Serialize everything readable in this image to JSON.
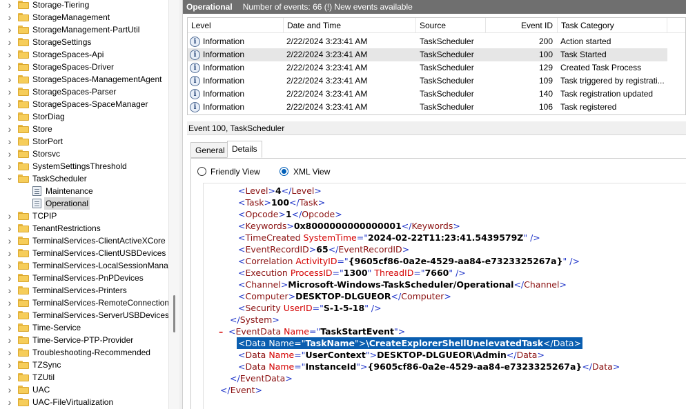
{
  "tree": {
    "items": [
      {
        "label": "Storage-Tiering",
        "type": "folder",
        "expanded": false
      },
      {
        "label": "StorageManagement",
        "type": "folder",
        "expanded": false
      },
      {
        "label": "StorageManagement-PartUtil",
        "type": "folder",
        "expanded": false
      },
      {
        "label": "StorageSettings",
        "type": "folder",
        "expanded": false
      },
      {
        "label": "StorageSpaces-Api",
        "type": "folder",
        "expanded": false
      },
      {
        "label": "StorageSpaces-Driver",
        "type": "folder",
        "expanded": false
      },
      {
        "label": "StorageSpaces-ManagementAgent",
        "type": "folder",
        "expanded": false
      },
      {
        "label": "StorageSpaces-Parser",
        "type": "folder",
        "expanded": false
      },
      {
        "label": "StorageSpaces-SpaceManager",
        "type": "folder",
        "expanded": false
      },
      {
        "label": "StorDiag",
        "type": "folder",
        "expanded": false
      },
      {
        "label": "Store",
        "type": "folder",
        "expanded": false
      },
      {
        "label": "StorPort",
        "type": "folder",
        "expanded": false
      },
      {
        "label": "Storsvc",
        "type": "folder",
        "expanded": false
      },
      {
        "label": "SystemSettingsThreshold",
        "type": "folder",
        "expanded": false
      },
      {
        "label": "TaskScheduler",
        "type": "folder",
        "expanded": true
      },
      {
        "label": "Maintenance",
        "type": "log",
        "child": true
      },
      {
        "label": "Operational",
        "type": "log",
        "child": true,
        "selected": true
      },
      {
        "label": "TCPIP",
        "type": "folder",
        "expanded": false
      },
      {
        "label": "TenantRestrictions",
        "type": "folder",
        "expanded": false
      },
      {
        "label": "TerminalServices-ClientActiveXCore",
        "type": "folder",
        "expanded": false
      },
      {
        "label": "TerminalServices-ClientUSBDevices",
        "type": "folder",
        "expanded": false
      },
      {
        "label": "TerminalServices-LocalSessionManag",
        "type": "folder",
        "expanded": false
      },
      {
        "label": "TerminalServices-PnPDevices",
        "type": "folder",
        "expanded": false
      },
      {
        "label": "TerminalServices-Printers",
        "type": "folder",
        "expanded": false
      },
      {
        "label": "TerminalServices-RemoteConnection",
        "type": "folder",
        "expanded": false
      },
      {
        "label": "TerminalServices-ServerUSBDevices",
        "type": "folder",
        "expanded": false
      },
      {
        "label": "Time-Service",
        "type": "folder",
        "expanded": false
      },
      {
        "label": "Time-Service-PTP-Provider",
        "type": "folder",
        "expanded": false
      },
      {
        "label": "Troubleshooting-Recommended",
        "type": "folder",
        "expanded": false
      },
      {
        "label": "TZSync",
        "type": "folder",
        "expanded": false
      },
      {
        "label": "TZUtil",
        "type": "folder",
        "expanded": false
      },
      {
        "label": "UAC",
        "type": "folder",
        "expanded": false
      },
      {
        "label": "UAC-FileVirtualization",
        "type": "folder",
        "expanded": false
      }
    ]
  },
  "list_header": {
    "title": "Operational",
    "count": "Number of events: 66 (!) New events available"
  },
  "columns": [
    "Level",
    "Date and Time",
    "Source",
    "Event ID",
    "Task Category"
  ],
  "events": [
    {
      "level": "Information",
      "date": "2/22/2024 3:23:41 AM",
      "source": "TaskScheduler",
      "id": "200",
      "category": "Action started"
    },
    {
      "level": "Information",
      "date": "2/22/2024 3:23:41 AM",
      "source": "TaskScheduler",
      "id": "100",
      "category": "Task Started",
      "selected": true
    },
    {
      "level": "Information",
      "date": "2/22/2024 3:23:41 AM",
      "source": "TaskScheduler",
      "id": "129",
      "category": "Created Task Process"
    },
    {
      "level": "Information",
      "date": "2/22/2024 3:23:41 AM",
      "source": "TaskScheduler",
      "id": "109",
      "category": "Task triggered by registrati..."
    },
    {
      "level": "Information",
      "date": "2/22/2024 3:23:41 AM",
      "source": "TaskScheduler",
      "id": "140",
      "category": "Task registration updated"
    },
    {
      "level": "Information",
      "date": "2/22/2024 3:23:41 AM",
      "source": "TaskScheduler",
      "id": "106",
      "category": "Task registered"
    }
  ],
  "details": {
    "header": "Event 100, TaskScheduler",
    "tabs": [
      "General",
      "Details"
    ],
    "active_tab": "Details",
    "view_options": [
      "Friendly View",
      "XML View"
    ],
    "selected_view": "XML View"
  },
  "xml": {
    "level": "4",
    "task": "100",
    "opcode": "1",
    "keywords": "0x8000000000000001",
    "system_time": "2024-02-22T11:23:41.5439579Z",
    "event_record_id": "65",
    "activity_id": "{9605cf86-0a2e-4529-aa84-e7323325267a}",
    "process_id": "1300",
    "thread_id": "7660",
    "channel": "Microsoft-Windows-TaskScheduler/Operational",
    "computer": "DESKTOP-DLGUEOR",
    "user_id": "S-1-5-18",
    "event_data_name": "TaskStartEvent",
    "data": [
      {
        "name": "TaskName",
        "value": "\\CreateExplorerShellUnelevatedTask",
        "selected": true
      },
      {
        "name": "UserContext",
        "value": "DESKTOP-DLGUEOR\\Admin"
      },
      {
        "name": "InstanceId",
        "value": "{9605cf86-0a2e-4529-aa84-e7323325267a}"
      }
    ]
  },
  "colors": {
    "header_bg": "#6f6f6f",
    "selection": "#0a5eb0",
    "xml_tag": "#8a1010",
    "xml_attr": "#d40000",
    "xml_bracket": "#1d33c8"
  }
}
